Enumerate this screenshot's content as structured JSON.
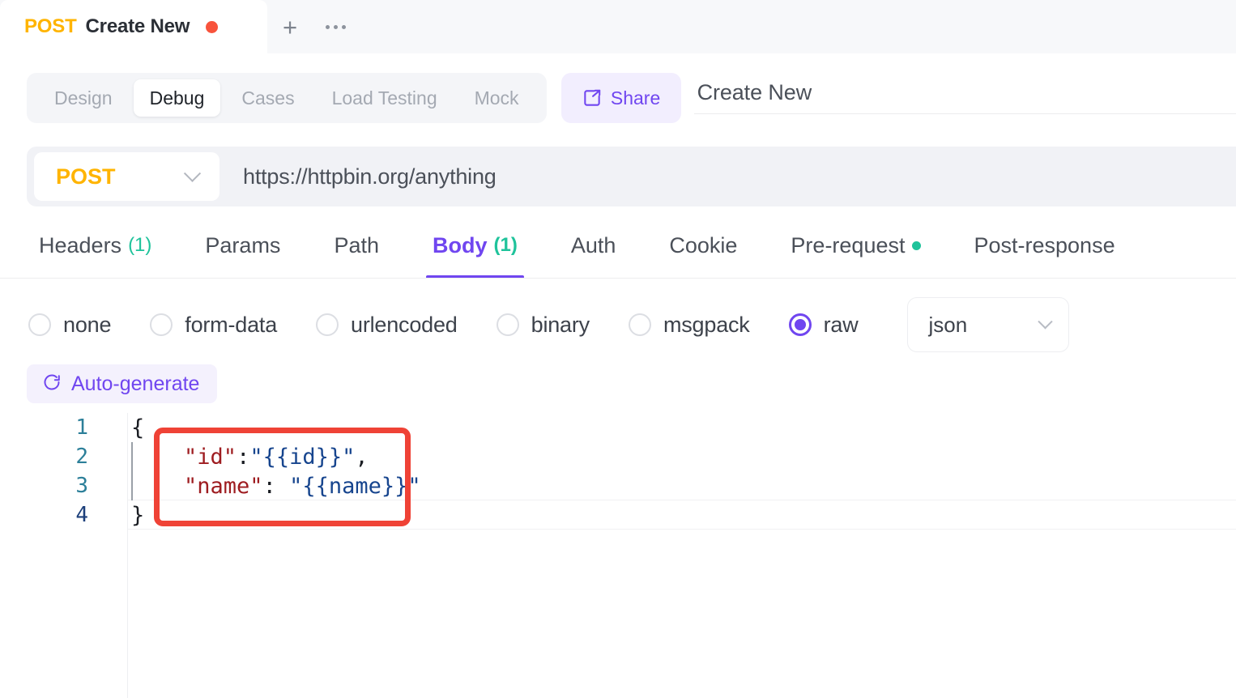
{
  "colors": {
    "accent": "#7046f0",
    "method": "#ffb400",
    "count_badge": "#1fc39b",
    "tab_dirty_dot": "#f8533c",
    "annotation": "#ef4236"
  },
  "tabstrip": {
    "active_tab": {
      "method": "POST",
      "title": "Create New",
      "dirty": true
    },
    "new_tab_label": "+",
    "more_label": "···"
  },
  "header": {
    "mode_tabs": [
      {
        "label": "Design",
        "selected": false
      },
      {
        "label": "Debug",
        "selected": true
      },
      {
        "label": "Cases",
        "selected": false
      },
      {
        "label": "Load Testing",
        "selected": false
      },
      {
        "label": "Mock",
        "selected": false
      }
    ],
    "share_label": "Share",
    "request_title": "Create New"
  },
  "url_bar": {
    "method": "POST",
    "url": "https://httpbin.org/anything"
  },
  "sub_tabs": [
    {
      "label": "Headers",
      "count": "(1)",
      "selected": false,
      "dot": false
    },
    {
      "label": "Params",
      "count": "",
      "selected": false,
      "dot": false
    },
    {
      "label": "Path",
      "count": "",
      "selected": false,
      "dot": false
    },
    {
      "label": "Body",
      "count": "(1)",
      "selected": true,
      "dot": false
    },
    {
      "label": "Auth",
      "count": "",
      "selected": false,
      "dot": false
    },
    {
      "label": "Cookie",
      "count": "",
      "selected": false,
      "dot": false
    },
    {
      "label": "Pre-request",
      "count": "",
      "selected": false,
      "dot": true
    },
    {
      "label": "Post-response",
      "count": "",
      "selected": false,
      "dot": false
    }
  ],
  "body_type": {
    "options": [
      {
        "label": "none",
        "selected": false
      },
      {
        "label": "form-data",
        "selected": false
      },
      {
        "label": "urlencoded",
        "selected": false
      },
      {
        "label": "binary",
        "selected": false
      },
      {
        "label": "msgpack",
        "selected": false
      },
      {
        "label": "raw",
        "selected": true
      }
    ],
    "format_value": "json"
  },
  "auto_generate": {
    "label": "Auto-generate"
  },
  "editor": {
    "line_numbers": [
      "1",
      "2",
      "3",
      "4"
    ],
    "active_line": 4,
    "lines": [
      {
        "plain": "{"
      },
      {
        "indent": "    ",
        "key": "\"id\"",
        "sep": ":",
        "tpl": "\"{{id}}\"",
        "tail": ","
      },
      {
        "indent": "    ",
        "key": "\"name\"",
        "sep": ": ",
        "tpl": "\"{{name}}\"",
        "tail": ""
      },
      {
        "plain": "}"
      }
    ],
    "raw_text": "{\n    \"id\":\"{{id}}\",\n    \"name\": \"{{name}}\"\n}"
  },
  "annotation": {
    "shape": "rounded-rect",
    "color": "#ef4236",
    "highlights_lines": [
      2,
      3
    ]
  }
}
